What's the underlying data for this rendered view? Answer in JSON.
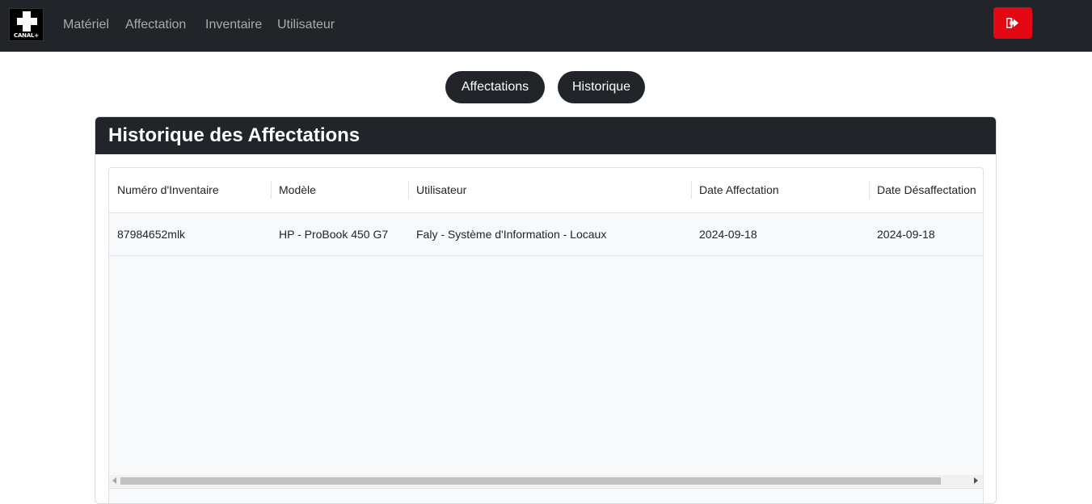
{
  "navbar": {
    "logo_text": "CANAL+",
    "links": [
      "Matériel",
      "Affectation",
      "Inventaire",
      "Utilisateur"
    ],
    "logout_icon": "sign-out-icon",
    "logout_color": "#e30613"
  },
  "tabs": {
    "affectations": "Affectations",
    "historique": "Historique"
  },
  "card": {
    "title": "Historique des Affectations"
  },
  "table": {
    "columns": [
      "Numéro d'Inventaire",
      "Modèle",
      "Utilisateur",
      "Date Affectation",
      "Date Désaffectation"
    ],
    "rows": [
      [
        "87984652mlk",
        "HP - ProBook 450 G7",
        "Faly - Système d'Information - Locaux",
        "2024-09-18",
        "2024-09-18"
      ]
    ]
  }
}
